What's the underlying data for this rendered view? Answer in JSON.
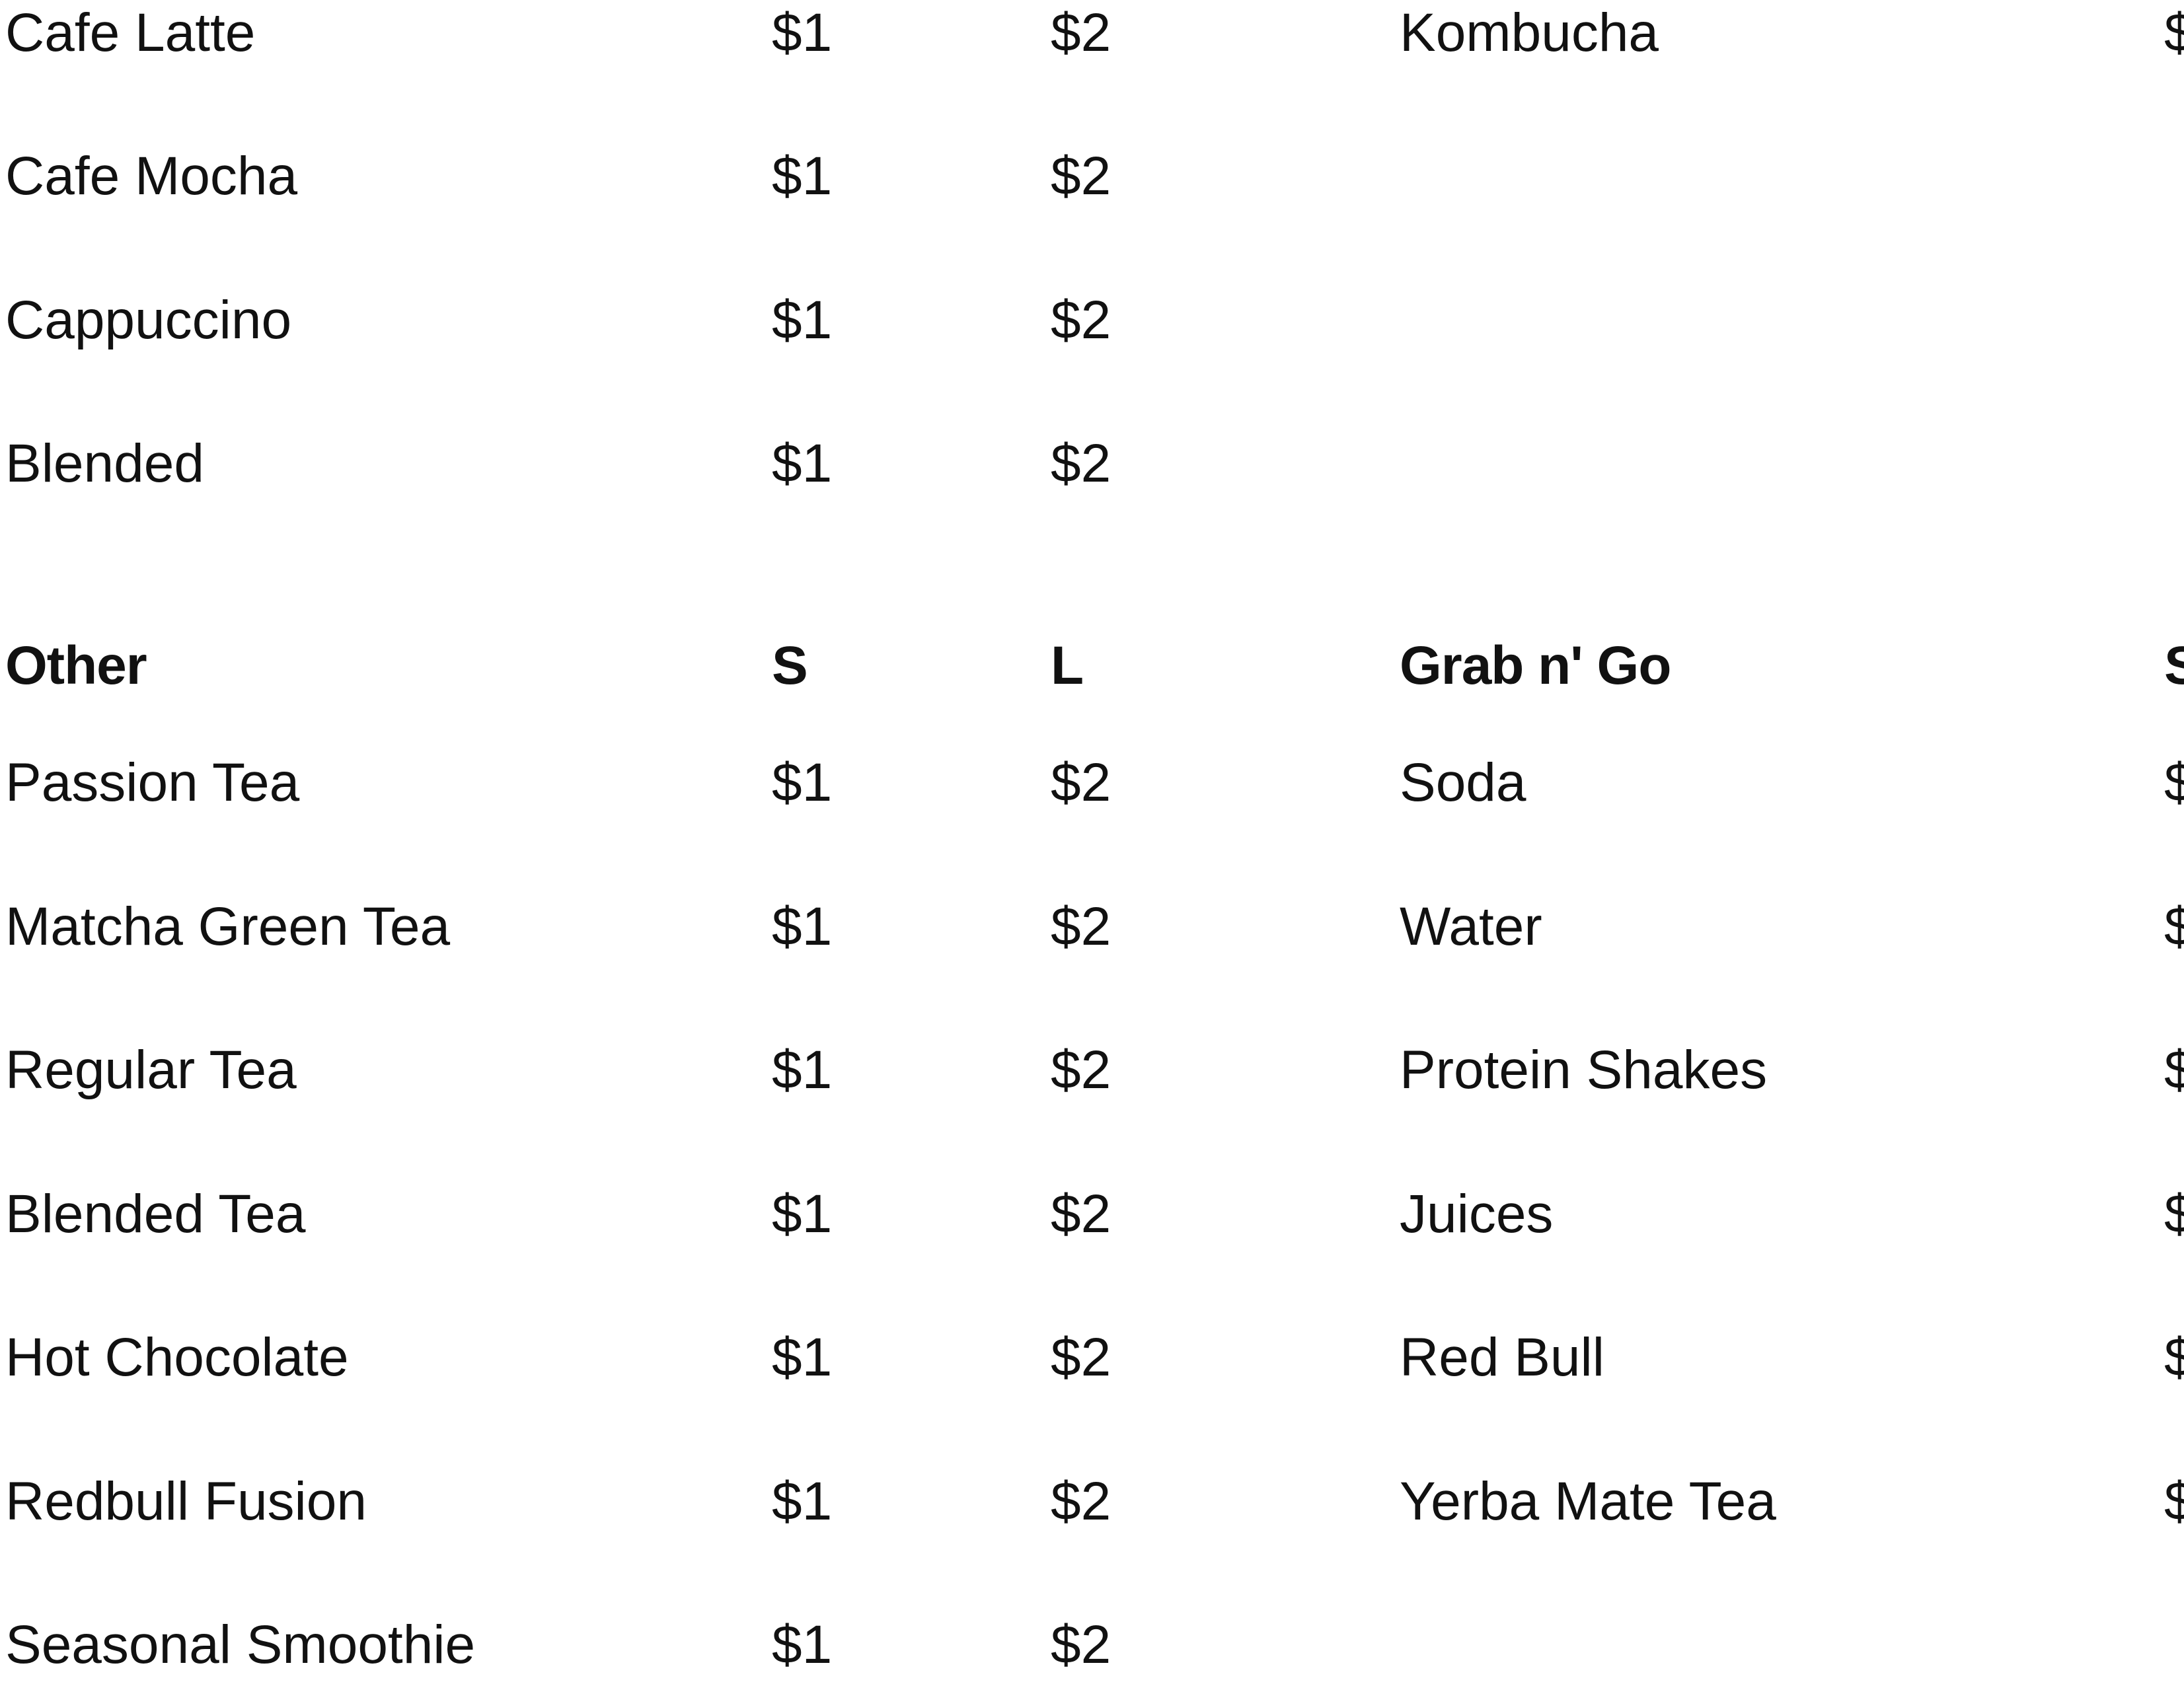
{
  "top_left": [
    {
      "name": "Cafe Latte",
      "small": "$1",
      "large": "$2"
    },
    {
      "name": "Cafe Mocha",
      "small": "$1",
      "large": "$2"
    },
    {
      "name": "Cappuccino",
      "small": "$1",
      "large": "$2"
    },
    {
      "name": "Blended",
      "small": "$1",
      "large": "$2"
    }
  ],
  "top_right": [
    {
      "name": "Kombucha",
      "small": "$"
    }
  ],
  "other": {
    "heading": "Other",
    "col_small": "S",
    "col_large": "L",
    "items": [
      {
        "name": "Passion Tea",
        "small": "$1",
        "large": "$2"
      },
      {
        "name": "Matcha Green Tea",
        "small": "$1",
        "large": "$2"
      },
      {
        "name": "Regular Tea",
        "small": "$1",
        "large": "$2"
      },
      {
        "name": "Blended Tea",
        "small": "$1",
        "large": "$2"
      },
      {
        "name": "Hot Chocolate",
        "small": "$1",
        "large": "$2"
      },
      {
        "name": "Redbull Fusion",
        "small": "$1",
        "large": "$2"
      },
      {
        "name": "Seasonal Smoothie",
        "small": "$1",
        "large": "$2"
      }
    ]
  },
  "grab_n_go": {
    "heading": "Grab n' Go",
    "col_small": "S",
    "items": [
      {
        "name": "Soda",
        "small": "$"
      },
      {
        "name": "Water",
        "small": "$"
      },
      {
        "name": "Protein Shakes",
        "small": "$"
      },
      {
        "name": "Juices",
        "small": "$"
      },
      {
        "name": "Red Bull",
        "small": "$"
      },
      {
        "name": "Yerba Mate Tea",
        "small": "$"
      }
    ]
  }
}
